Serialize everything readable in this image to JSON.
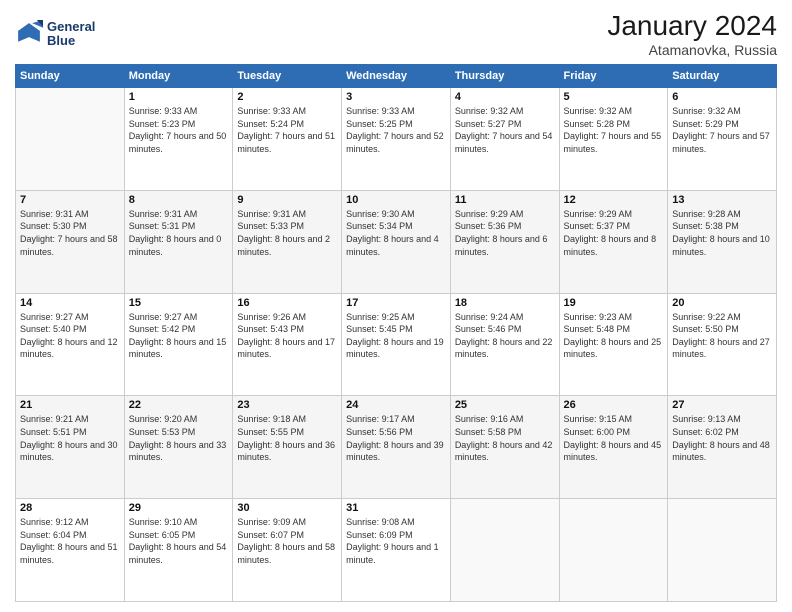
{
  "header": {
    "logo_line1": "General",
    "logo_line2": "Blue",
    "month_year": "January 2024",
    "location": "Atamanovka, Russia"
  },
  "days_of_week": [
    "Sunday",
    "Monday",
    "Tuesday",
    "Wednesday",
    "Thursday",
    "Friday",
    "Saturday"
  ],
  "weeks": [
    [
      {
        "day": "",
        "sunrise": "",
        "sunset": "",
        "daylight": ""
      },
      {
        "day": "1",
        "sunrise": "9:33 AM",
        "sunset": "5:23 PM",
        "daylight": "7 hours and 50 minutes."
      },
      {
        "day": "2",
        "sunrise": "9:33 AM",
        "sunset": "5:24 PM",
        "daylight": "7 hours and 51 minutes."
      },
      {
        "day": "3",
        "sunrise": "9:33 AM",
        "sunset": "5:25 PM",
        "daylight": "7 hours and 52 minutes."
      },
      {
        "day": "4",
        "sunrise": "9:32 AM",
        "sunset": "5:27 PM",
        "daylight": "7 hours and 54 minutes."
      },
      {
        "day": "5",
        "sunrise": "9:32 AM",
        "sunset": "5:28 PM",
        "daylight": "7 hours and 55 minutes."
      },
      {
        "day": "6",
        "sunrise": "9:32 AM",
        "sunset": "5:29 PM",
        "daylight": "7 hours and 57 minutes."
      }
    ],
    [
      {
        "day": "7",
        "sunrise": "9:31 AM",
        "sunset": "5:30 PM",
        "daylight": "7 hours and 58 minutes."
      },
      {
        "day": "8",
        "sunrise": "9:31 AM",
        "sunset": "5:31 PM",
        "daylight": "8 hours and 0 minutes."
      },
      {
        "day": "9",
        "sunrise": "9:31 AM",
        "sunset": "5:33 PM",
        "daylight": "8 hours and 2 minutes."
      },
      {
        "day": "10",
        "sunrise": "9:30 AM",
        "sunset": "5:34 PM",
        "daylight": "8 hours and 4 minutes."
      },
      {
        "day": "11",
        "sunrise": "9:29 AM",
        "sunset": "5:36 PM",
        "daylight": "8 hours and 6 minutes."
      },
      {
        "day": "12",
        "sunrise": "9:29 AM",
        "sunset": "5:37 PM",
        "daylight": "8 hours and 8 minutes."
      },
      {
        "day": "13",
        "sunrise": "9:28 AM",
        "sunset": "5:38 PM",
        "daylight": "8 hours and 10 minutes."
      }
    ],
    [
      {
        "day": "14",
        "sunrise": "9:27 AM",
        "sunset": "5:40 PM",
        "daylight": "8 hours and 12 minutes."
      },
      {
        "day": "15",
        "sunrise": "9:27 AM",
        "sunset": "5:42 PM",
        "daylight": "8 hours and 15 minutes."
      },
      {
        "day": "16",
        "sunrise": "9:26 AM",
        "sunset": "5:43 PM",
        "daylight": "8 hours and 17 minutes."
      },
      {
        "day": "17",
        "sunrise": "9:25 AM",
        "sunset": "5:45 PM",
        "daylight": "8 hours and 19 minutes."
      },
      {
        "day": "18",
        "sunrise": "9:24 AM",
        "sunset": "5:46 PM",
        "daylight": "8 hours and 22 minutes."
      },
      {
        "day": "19",
        "sunrise": "9:23 AM",
        "sunset": "5:48 PM",
        "daylight": "8 hours and 25 minutes."
      },
      {
        "day": "20",
        "sunrise": "9:22 AM",
        "sunset": "5:50 PM",
        "daylight": "8 hours and 27 minutes."
      }
    ],
    [
      {
        "day": "21",
        "sunrise": "9:21 AM",
        "sunset": "5:51 PM",
        "daylight": "8 hours and 30 minutes."
      },
      {
        "day": "22",
        "sunrise": "9:20 AM",
        "sunset": "5:53 PM",
        "daylight": "8 hours and 33 minutes."
      },
      {
        "day": "23",
        "sunrise": "9:18 AM",
        "sunset": "5:55 PM",
        "daylight": "8 hours and 36 minutes."
      },
      {
        "day": "24",
        "sunrise": "9:17 AM",
        "sunset": "5:56 PM",
        "daylight": "8 hours and 39 minutes."
      },
      {
        "day": "25",
        "sunrise": "9:16 AM",
        "sunset": "5:58 PM",
        "daylight": "8 hours and 42 minutes."
      },
      {
        "day": "26",
        "sunrise": "9:15 AM",
        "sunset": "6:00 PM",
        "daylight": "8 hours and 45 minutes."
      },
      {
        "day": "27",
        "sunrise": "9:13 AM",
        "sunset": "6:02 PM",
        "daylight": "8 hours and 48 minutes."
      }
    ],
    [
      {
        "day": "28",
        "sunrise": "9:12 AM",
        "sunset": "6:04 PM",
        "daylight": "8 hours and 51 minutes."
      },
      {
        "day": "29",
        "sunrise": "9:10 AM",
        "sunset": "6:05 PM",
        "daylight": "8 hours and 54 minutes."
      },
      {
        "day": "30",
        "sunrise": "9:09 AM",
        "sunset": "6:07 PM",
        "daylight": "8 hours and 58 minutes."
      },
      {
        "day": "31",
        "sunrise": "9:08 AM",
        "sunset": "6:09 PM",
        "daylight": "9 hours and 1 minute."
      },
      {
        "day": "",
        "sunrise": "",
        "sunset": "",
        "daylight": ""
      },
      {
        "day": "",
        "sunrise": "",
        "sunset": "",
        "daylight": ""
      },
      {
        "day": "",
        "sunrise": "",
        "sunset": "",
        "daylight": ""
      }
    ]
  ],
  "labels": {
    "sunrise_prefix": "Sunrise: ",
    "sunset_prefix": "Sunset: ",
    "daylight_prefix": "Daylight: "
  }
}
